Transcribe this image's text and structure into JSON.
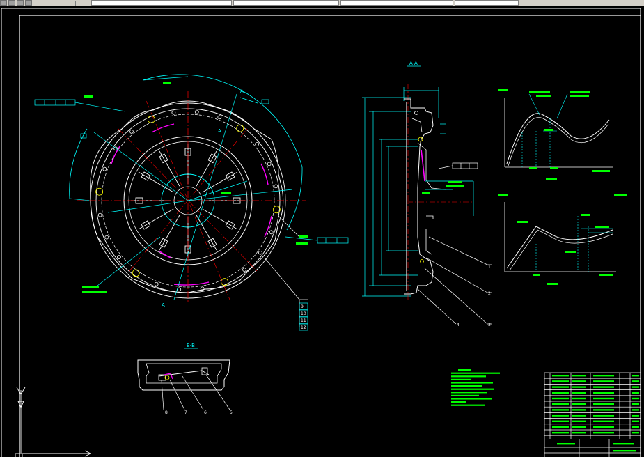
{
  "toolbar": {
    "icons": [
      "tool-icon",
      "tool-icon",
      "tool-icon",
      "tool-icon",
      "tool-icon"
    ]
  },
  "views": {
    "section_aa": "A-A",
    "section_bb": "B-B",
    "section_letter": "A"
  },
  "part_numbers": [
    "1",
    "2",
    "3",
    "4",
    "9",
    "10",
    "11",
    "12",
    "8",
    "7",
    "6",
    "5"
  ],
  "colors": {
    "white": "#ffffff",
    "cyan": "#00ffff",
    "green": "#00ff00",
    "red": "#ff0000",
    "magenta": "#ff00ff",
    "yellow": "#ffff00",
    "background": "#000000"
  }
}
